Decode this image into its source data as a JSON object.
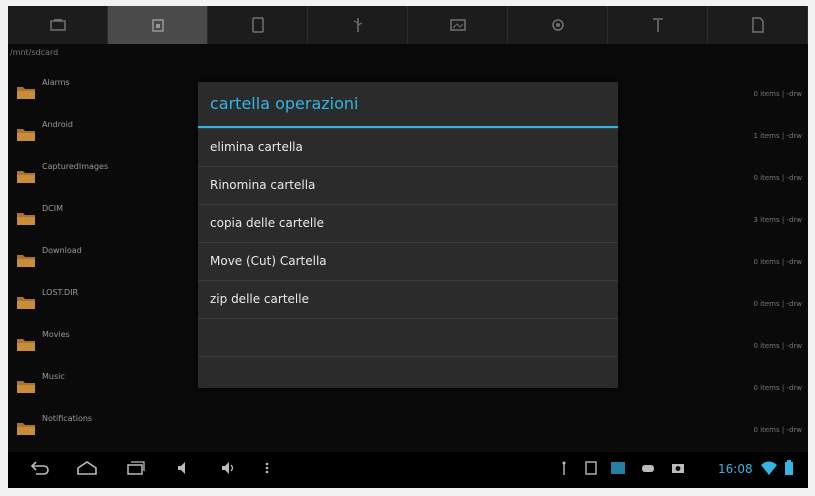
{
  "tabs": [
    {
      "icon": "sdcard-icon",
      "active": false
    },
    {
      "icon": "home-folder-icon",
      "active": true
    },
    {
      "icon": "tablet-icon",
      "active": false
    },
    {
      "icon": "usb-icon",
      "active": false
    },
    {
      "icon": "image-icon",
      "active": false
    },
    {
      "icon": "settings-icon",
      "active": false
    },
    {
      "icon": "antenna-icon",
      "active": false
    },
    {
      "icon": "file-icon",
      "active": false
    }
  ],
  "path": "/mnt/sdcard",
  "files": [
    {
      "name": "Alarms",
      "meta": "0 items | -drw"
    },
    {
      "name": "Android",
      "meta": "1 items | -drw"
    },
    {
      "name": "CapturedImages",
      "meta": "0 items | -drw"
    },
    {
      "name": "DCIM",
      "meta": "3 items | -drw"
    },
    {
      "name": "Download",
      "meta": "0 items | -drw"
    },
    {
      "name": "LOST.DIR",
      "meta": "0 items | -drw"
    },
    {
      "name": "Movies",
      "meta": "0 items | -drw"
    },
    {
      "name": "Music",
      "meta": "0 items | -drw"
    },
    {
      "name": "Notifications",
      "meta": "0 items | -drw"
    }
  ],
  "dialog": {
    "title": "cartella operazioni",
    "items": [
      {
        "label": "elimina cartella",
        "enabled": true
      },
      {
        "label": "Rinomina cartella",
        "enabled": true
      },
      {
        "label": "copia delle cartelle",
        "enabled": true
      },
      {
        "label": "Move (Cut) Cartella",
        "enabled": true
      },
      {
        "label": "zip delle cartelle",
        "enabled": true
      },
      {
        "label": "",
        "enabled": false
      },
      {
        "label": "",
        "enabled": false
      }
    ]
  },
  "status": {
    "time": "16:08",
    "accent": "#33b5e5"
  }
}
